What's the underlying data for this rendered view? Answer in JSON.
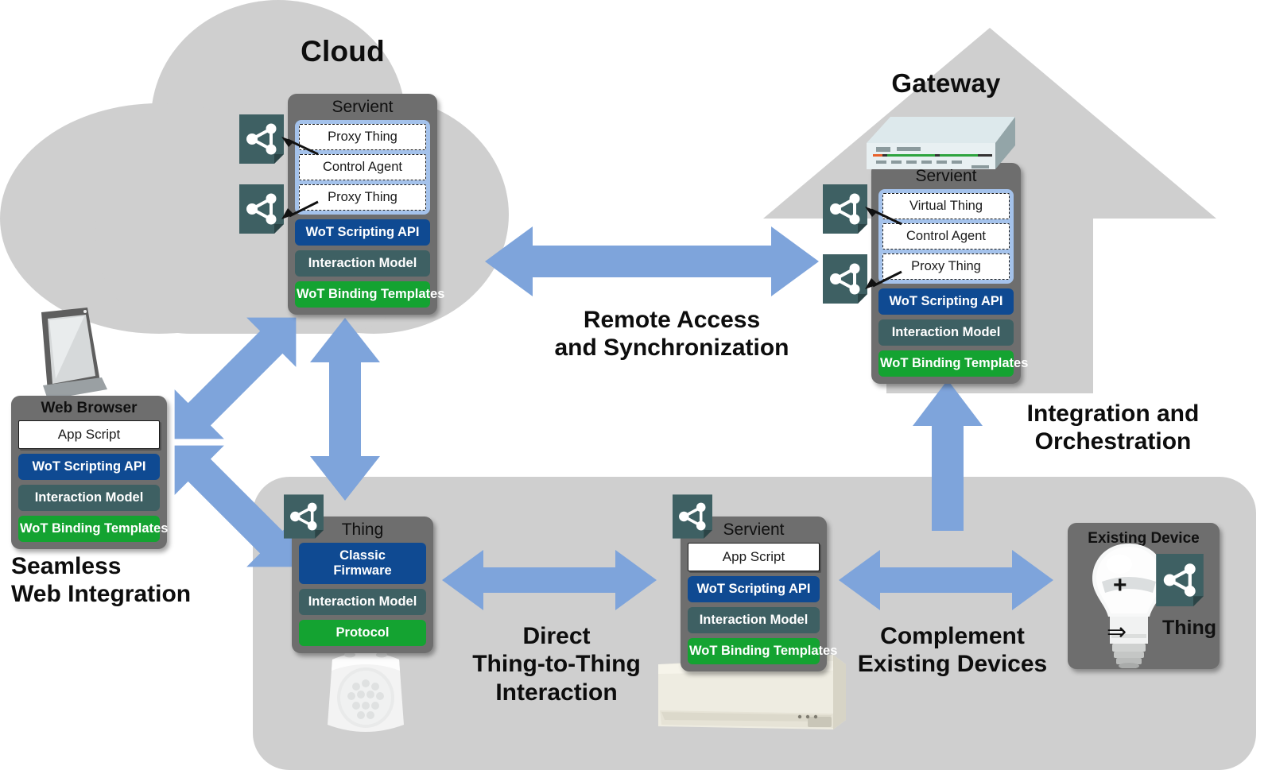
{
  "diagram": {
    "title": "W3C Web of Things architecture deployment scenarios"
  },
  "regions": {
    "cloud": {
      "label": "Cloud"
    },
    "gateway": {
      "label": "Gateway"
    }
  },
  "cloud_servient": {
    "title": "Servient",
    "things": [
      "Proxy Thing",
      "Control Agent",
      "Proxy Thing"
    ],
    "layers": [
      "WoT Scripting API",
      "Interaction Model",
      "WoT Binding Templates"
    ]
  },
  "gateway_servient": {
    "title": "Servient",
    "things": [
      "Virtual Thing",
      "Control Agent",
      "Proxy Thing"
    ],
    "layers": [
      "WoT Scripting API",
      "Interaction Model",
      "WoT Binding Templates"
    ]
  },
  "web_browser": {
    "title": "Web Browser",
    "app_script": "App Script",
    "layers": [
      "WoT Scripting API",
      "Interaction Model",
      "WoT Binding Templates"
    ]
  },
  "thing_device": {
    "title": "Thing",
    "firmware": "Classic\nFirmware",
    "firmware_line1": "Classic",
    "firmware_line2": "Firmware",
    "layers": [
      "Interaction Model",
      "Protocol"
    ]
  },
  "bottom_servient": {
    "title": "Servient",
    "app_script": "App Script",
    "layers": [
      "WoT Scripting API",
      "Interaction Model",
      "WoT Binding Templates"
    ]
  },
  "existing_device": {
    "title": "Existing Device",
    "plus": "+",
    "implies": "⇒",
    "result": "Thing"
  },
  "captions": {
    "remote_access_l1": "Remote Access",
    "remote_access_l2": "and Synchronization",
    "integration_l1": "Integration and",
    "integration_l2": "Orchestration",
    "seamless_l1": "Seamless",
    "seamless_l2": "Web Integration",
    "direct_l1": "Direct",
    "direct_l2": "Thing-to-Thing",
    "direct_l3": "Interaction",
    "complement_l1": "Complement",
    "complement_l2": "Existing Devices"
  },
  "icons": {
    "wot_thing_icon": "wot-thing-icon",
    "laptop_icon": "laptop-icon",
    "router_icon": "router-icon",
    "motion_sensor_icon": "motion-sensor-icon",
    "air_conditioner_icon": "air-conditioner-icon",
    "light_bulb_icon": "light-bulb-icon"
  },
  "colors": {
    "region_gray": "#cfcfcf",
    "box_gray": "#6e6e6e",
    "scripting_blue": "#0f4a92",
    "interaction_teal": "#3e6063",
    "binding_green": "#14a331",
    "thing_group_blue": "#a4c2eb",
    "arrow_blue": "#7ea4db",
    "wot_icon_teal": "#3e6063"
  }
}
